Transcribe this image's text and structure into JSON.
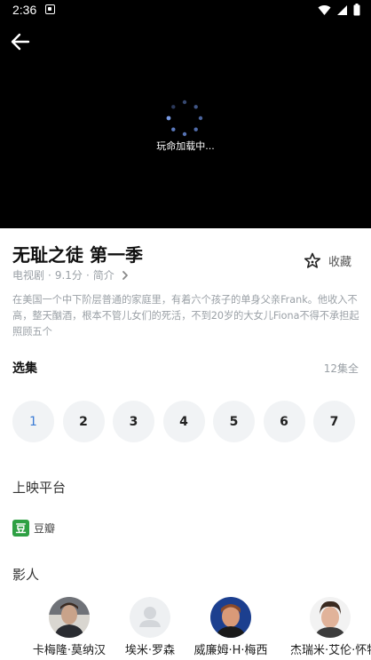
{
  "status_bar": {
    "time": "2:36"
  },
  "player": {
    "loading_text": "玩命加载中..."
  },
  "show": {
    "title": "无耻之徒 第一季",
    "category": "电视剧",
    "rating": "9.1分",
    "intro_label": "简介",
    "collect_label": "收藏",
    "description": "在美国一个中下阶层普通的家庭里，有着六个孩子的单身父亲Frank。他收入不高，整天酗酒，根本不管儿女们的死活，不到20岁的大女儿Fiona不得不承担起照顾五个"
  },
  "episodes": {
    "title": "选集",
    "count_label": "12集全",
    "items": [
      "1",
      "2",
      "3",
      "4",
      "5",
      "6",
      "7"
    ]
  },
  "platforms": {
    "title": "上映平台",
    "items": [
      {
        "logo": "豆",
        "name": "豆瓣"
      }
    ]
  },
  "cast": {
    "title": "影人",
    "items": [
      {
        "name": "卡梅隆·莫纳汉"
      },
      {
        "name": "埃米·罗森"
      },
      {
        "name": "威廉姆·H·梅西"
      },
      {
        "name": "杰瑞米·艾伦·怀特"
      }
    ]
  },
  "colors": {
    "accent": "#3a7bd5",
    "douban": "#2ea043"
  }
}
